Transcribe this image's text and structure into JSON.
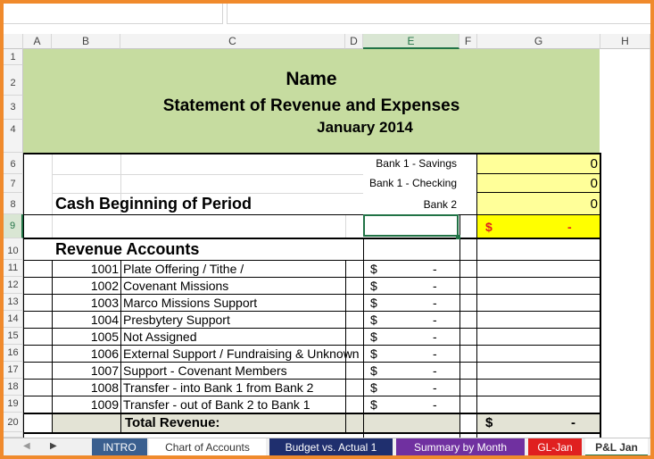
{
  "sheet": {
    "columns": [
      "A",
      "B",
      "C",
      "D",
      "E",
      "F",
      "G",
      "H"
    ],
    "rows": [
      "1",
      "2",
      "3",
      "4",
      "6",
      "7",
      "8",
      "9",
      "10",
      "11",
      "12",
      "13",
      "14",
      "15",
      "16",
      "17",
      "18",
      "19",
      "20"
    ],
    "title": "Name",
    "subtitle": "Statement of Revenue and Expenses",
    "period": "January  2014"
  },
  "bank": {
    "savings_label": "Bank 1 - Savings",
    "savings_value": "0",
    "checking_label": "Bank 1 - Checking",
    "checking_value": "0",
    "bank2_label": "Bank 2",
    "bank2_value": "0"
  },
  "cash_beginning_label": "Cash Beginning of Period",
  "cash_total": {
    "currency": "$",
    "value": "-"
  },
  "revenue_header": "Revenue Accounts",
  "accounts": [
    {
      "code": "1001",
      "name": "Plate Offering / Tithe /",
      "currency": "$",
      "amount": "-"
    },
    {
      "code": "1002",
      "name": "Covenant Missions",
      "currency": "$",
      "amount": "-"
    },
    {
      "code": "1003",
      "name": "Marco Missions Support",
      "currency": "$",
      "amount": "-"
    },
    {
      "code": "1004",
      "name": "Presbytery Support",
      "currency": "$",
      "amount": "-"
    },
    {
      "code": "1005",
      "name": "Not Assigned",
      "currency": "$",
      "amount": "-"
    },
    {
      "code": "1006",
      "name": "External Support / Fundraising & Unknown",
      "currency": "$",
      "amount": "-"
    },
    {
      "code": "1007",
      "name": "Support - Covenant Members",
      "currency": "$",
      "amount": "-"
    },
    {
      "code": "1008",
      "name": "Transfer - into Bank 1 from Bank 2",
      "currency": "$",
      "amount": "-"
    },
    {
      "code": "1009",
      "name": "Transfer - out of Bank 2 to Bank 1",
      "currency": "$",
      "amount": "-"
    }
  ],
  "total_revenue": {
    "label": "Total Revenue:",
    "currency": "$",
    "value": "-"
  },
  "tabs": [
    {
      "label": "INTRO",
      "bg": "#3a5f8f"
    },
    {
      "label": "Chart of Accounts",
      "bg": "#ffffff"
    },
    {
      "label": "Budget vs. Actual 1",
      "bg": "#1f2f6e"
    },
    {
      "label": "Summary by Month",
      "bg": "#7030a0"
    },
    {
      "label": "GL-Jan",
      "bg": "#e02020"
    },
    {
      "label": "P&L Jan",
      "bg": "#ffffff"
    }
  ],
  "colors": {
    "banner": "#c6dca0",
    "highlight": "#ffff99",
    "frame": "#f08a2c",
    "selection": "#217346"
  }
}
